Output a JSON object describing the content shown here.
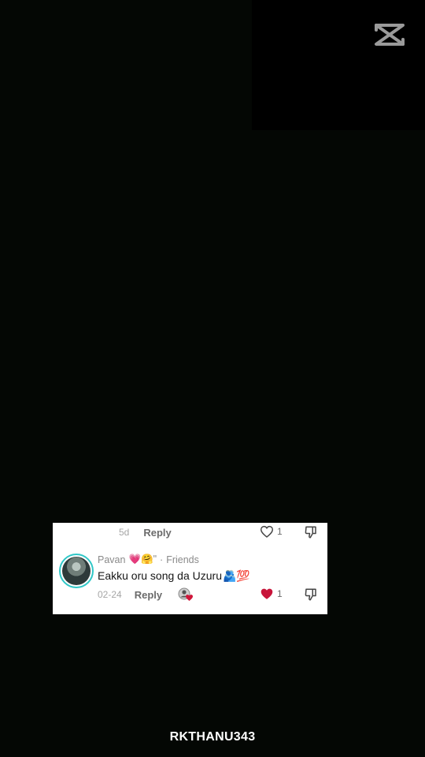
{
  "previous_comment": {
    "time": "5d",
    "reply_label": "Reply",
    "like_count": "1"
  },
  "comment": {
    "username": "Pavan",
    "username_emojis": "💗🤗\"",
    "separator": "·",
    "relation": "Friends",
    "text": "Eakku oru song da Uzuru",
    "text_emojis": "🫂💯",
    "time": "02-24",
    "reply_label": "Reply",
    "like_count": "1",
    "liked": true
  },
  "colors": {
    "background": "#040704",
    "card": "#ffffff",
    "like_active": "#d0163a",
    "avatar_ring": "#2fc7c7"
  },
  "icons": [
    "capcut-logo-icon",
    "heart-icon",
    "dislike-icon",
    "creator-liked-icon"
  ],
  "footer": {
    "username": "RKTHANU343"
  }
}
